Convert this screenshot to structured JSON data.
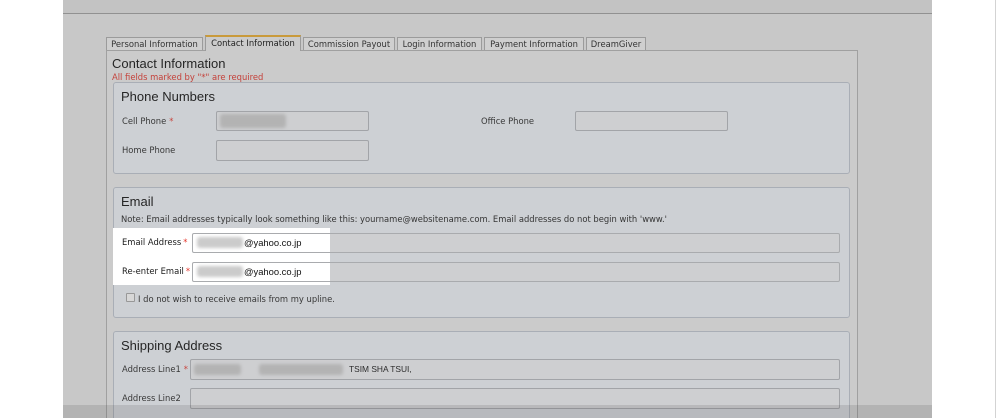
{
  "tabs": [
    {
      "label": "Personal Information",
      "active": false
    },
    {
      "label": "Contact Information",
      "active": true
    },
    {
      "label": "Commission Payout",
      "active": false
    },
    {
      "label": "Login Information",
      "active": false
    },
    {
      "label": "Payment Information",
      "active": false
    },
    {
      "label": "DreamGiver",
      "active": false
    }
  ],
  "page": {
    "title": "Contact Information",
    "required_note": "All fields marked by \"*\" are required",
    "required_marker": "*"
  },
  "phone_numbers": {
    "legend": "Phone Numbers",
    "cell_phone": {
      "label": "Cell Phone",
      "required": true,
      "value_obscured": true
    },
    "office_phone": {
      "label": "Office Phone",
      "required": false,
      "value": ""
    },
    "home_phone": {
      "label": "Home Phone",
      "required": false,
      "value": ""
    }
  },
  "email": {
    "legend": "Email",
    "note": "Note: Email addresses typically look something like this: yourname@websitename.com. Email addresses do not begin with 'www.'",
    "email_address": {
      "label": "Email Address",
      "required": true,
      "value_obscured": true,
      "visible_value": "@yahoo.co.jp"
    },
    "reenter_email": {
      "label": "Re-enter Email",
      "required": true,
      "value_obscured": true,
      "visible_value": "@yahoo.co.jp"
    },
    "no_upline_emails": {
      "label": "I do not wish to receive emails from my upline.",
      "checked": false
    }
  },
  "shipping_address": {
    "legend": "Shipping Address",
    "address_line1": {
      "label": "Address Line1",
      "required": true,
      "value_obscured": true,
      "visible_value": "TSIM SHA TSUI,"
    },
    "address_line2": {
      "label": "Address Line2",
      "required": false,
      "value": ""
    }
  },
  "colors": {
    "required_marker": "#e5352b",
    "active_tab_accent": "#c99a3b",
    "highlight": "#ffffff"
  }
}
